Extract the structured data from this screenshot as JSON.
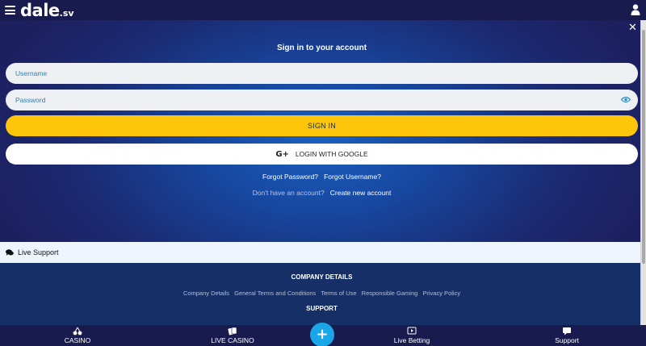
{
  "header": {
    "brand": "dale",
    "brand_tld": ".sv"
  },
  "login": {
    "title": "Sign in to your account",
    "username_placeholder": "Username",
    "password_placeholder": "Password",
    "sign_in_label": "SIGN IN",
    "google_label": "LOGIN WITH GOOGLE",
    "forgot_password": "Forgot Password?",
    "forgot_username": "Forgot Username?",
    "no_account": "Don't have an account?",
    "create_account": "Create new account"
  },
  "live_support": {
    "label": "Live Support"
  },
  "footer": {
    "company_heading": "COMPANY DETAILS",
    "links": [
      "Company Details",
      "General Terms and Conditions",
      "Terms of Use",
      "Responsible Gaming",
      "Privacy Policy"
    ],
    "support_heading": "SUPPORT"
  },
  "bottom_nav": {
    "casino": "CASINO",
    "live_casino": "LIVE CASINO",
    "fab": "+",
    "live_betting": "Live Betting",
    "support": "Support"
  },
  "icons": {
    "menu": "hamburger-menu-icon",
    "user": "user-icon",
    "close": "close-icon",
    "eye": "eye-icon",
    "google": "google-plus-icon",
    "chat": "chat-bubbles-icon",
    "casino": "cherries-icon",
    "live_casino": "cards-icon",
    "live_betting": "play-screen-icon",
    "support": "speech-bubble-icon"
  },
  "colors": {
    "sign_in_button": "#ffc50a",
    "fab": "#1aa6e8",
    "topbar": "#191a4d",
    "footer": "#162f66"
  }
}
